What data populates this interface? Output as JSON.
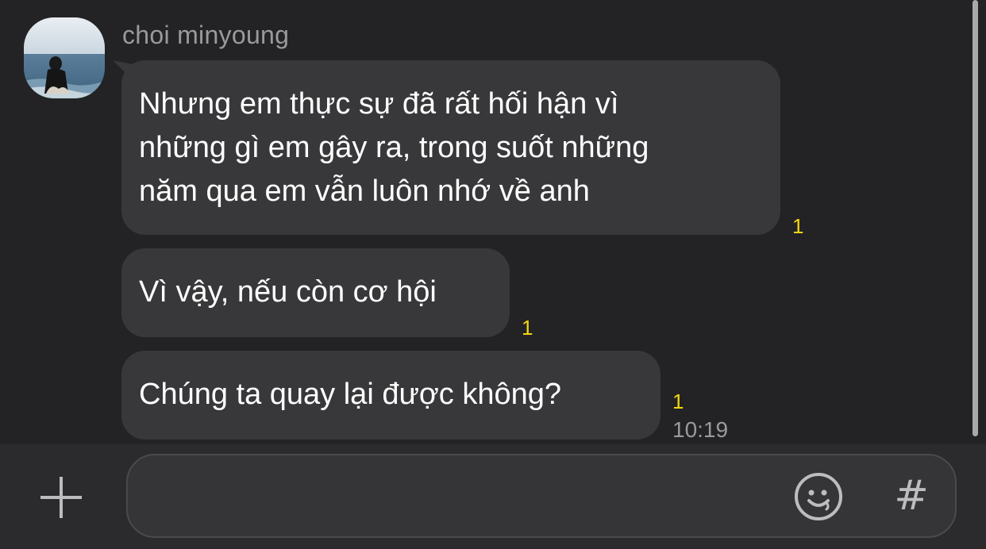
{
  "sender": {
    "name": "choi minyoung"
  },
  "messages": [
    {
      "lines": [
        "Nhưng em thực sự đã rất hối hận vì",
        "những gì em gây ra, trong suốt những",
        "năm qua em vẫn luôn nhớ về anh"
      ],
      "unread": "1"
    },
    {
      "lines": [
        "Vì vậy, nếu còn cơ hội"
      ],
      "unread": "1"
    },
    {
      "lines": [
        "Chúng ta quay lại được không?"
      ],
      "unread": "1",
      "time": "10:19"
    }
  ],
  "composer": {
    "placeholder": "",
    "hash_label": "#",
    "plus_icon": "plus-icon",
    "emoji_icon": "smiley-icon"
  },
  "colors": {
    "background": "#232325",
    "bubble": "#38383a",
    "unread": "#f2d60f"
  }
}
